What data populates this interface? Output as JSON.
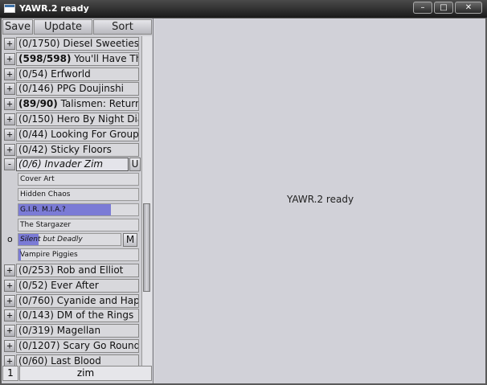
{
  "window": {
    "title": "YAWR.2 ready",
    "min": "–",
    "max": "□",
    "close": "✕"
  },
  "toolbar": {
    "save": "Save",
    "update": "Update",
    "sort": "Sort"
  },
  "feeds": [
    {
      "toggle": "+",
      "count": "(0/1750)",
      "name": "Diesel Sweeties",
      "bold": false
    },
    {
      "toggle": "+",
      "count": "(598/598)",
      "name": "You'll Have That",
      "bold": true
    },
    {
      "toggle": "+",
      "count": "(0/54)",
      "name": "Erfworld",
      "bold": false
    },
    {
      "toggle": "+",
      "count": "(0/146)",
      "name": "PPG Doujinshi",
      "bold": false
    },
    {
      "toggle": "+",
      "count": "(89/90)",
      "name": "Talismen: Return",
      "bold": true
    },
    {
      "toggle": "+",
      "count": "(0/150)",
      "name": "Hero By Night Dia",
      "bold": false
    },
    {
      "toggle": "+",
      "count": "(0/44)",
      "name": "Looking For Group",
      "bold": false
    },
    {
      "toggle": "+",
      "count": "(0/42)",
      "name": "Sticky Floors",
      "bold": false
    }
  ],
  "open_feed": {
    "toggle": "-",
    "count": "(0/6)",
    "name": "Invader Zim",
    "button": "U"
  },
  "strips": [
    {
      "title": "Cover Art",
      "progress": 0,
      "marker": "",
      "button": "",
      "italic": false
    },
    {
      "title": "Hidden Chaos",
      "progress": 0,
      "marker": "",
      "button": "",
      "italic": false
    },
    {
      "title": "G.I.R. M.I.A.?",
      "progress": 0.77,
      "marker": "",
      "button": "",
      "italic": false
    },
    {
      "title": "The Stargazer",
      "progress": 0,
      "marker": "",
      "button": "",
      "italic": false
    },
    {
      "title": "Silent but Deadly",
      "progress": 0.2,
      "marker": "o",
      "button": "M",
      "italic": true
    },
    {
      "title": "Vampire Piggies",
      "progress": 0.02,
      "marker": "",
      "button": "",
      "italic": false
    }
  ],
  "feeds_after": [
    {
      "toggle": "+",
      "count": "(0/253)",
      "name": "Rob and Elliot",
      "bold": false
    },
    {
      "toggle": "+",
      "count": "(0/52)",
      "name": "Ever After",
      "bold": false
    },
    {
      "toggle": "+",
      "count": "(0/760)",
      "name": "Cyanide and Happ",
      "bold": false
    },
    {
      "toggle": "+",
      "count": "(0/143)",
      "name": "DM of the Rings",
      "bold": false
    },
    {
      "toggle": "+",
      "count": "(0/319)",
      "name": "Magellan",
      "bold": false
    },
    {
      "toggle": "+",
      "count": "(0/1207)",
      "name": "Scary Go Round",
      "bold": false
    },
    {
      "toggle": "+",
      "count": "(0/60)",
      "name": "Last Blood",
      "bold": false
    }
  ],
  "status": {
    "count": "1",
    "filter": "zim"
  },
  "main": {
    "message": "YAWR.2 ready"
  },
  "colors": {
    "progress_fill": "#7b7bd6",
    "titlebar": "#1a1a1a"
  }
}
